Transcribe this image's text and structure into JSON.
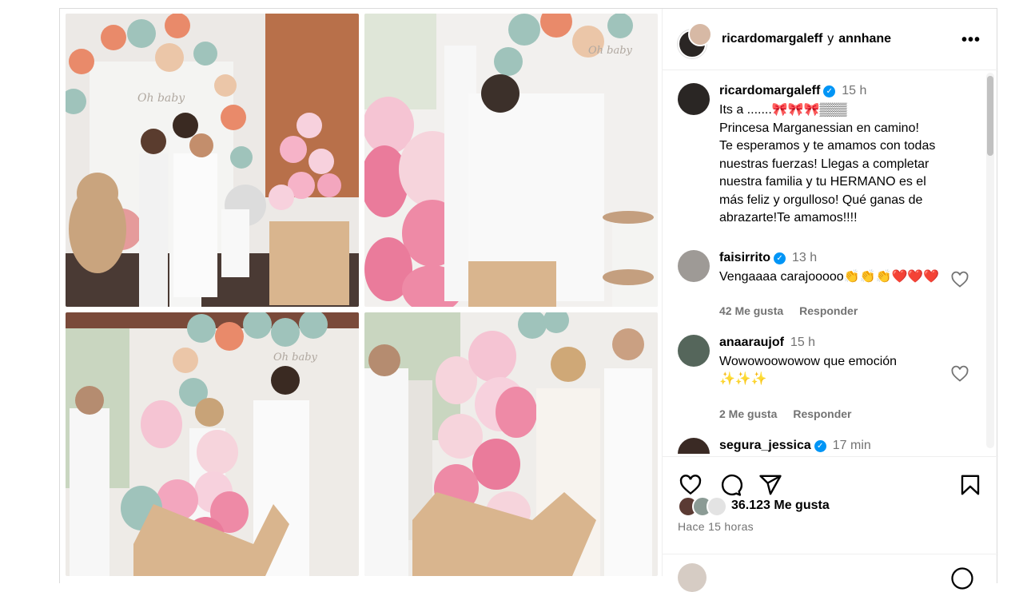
{
  "header": {
    "user1": "ricardomargaleff",
    "conjunction": "y",
    "user2": "annhane",
    "more_label": "•••"
  },
  "caption": {
    "user": "ricardomargaleff",
    "time": "15 h",
    "lines": [
      "Its a .......🎀🎀🎀▒▒▒",
      "Princesa Marganessian en camino!",
      "Te esperamos y te amamos con todas",
      "nuestras fuerzas! Llegas a completar",
      "nuestra familia y tu HERMANO es el",
      "más feliz y orgulloso! Qué ganas de",
      "abrazarte!Te amamos!!!!"
    ]
  },
  "comments": [
    {
      "user": "faisirrito",
      "time": "13 h",
      "text": "Vengaaaa carajooooo👏👏👏❤️❤️❤️",
      "likes": "42 Me gusta",
      "reply": "Responder"
    },
    {
      "user": "anaaraujof",
      "time": "15 h",
      "text": "Wowowoowowow que emoción",
      "text2": "✨✨✨",
      "likes": "2 Me gusta",
      "reply": "Responder"
    },
    {
      "user": "segura_jessica",
      "time": "17 min"
    }
  ],
  "post": {
    "likes_count": "36.123 Me gusta",
    "time_ago": "Hace 15 horas"
  },
  "photos": {
    "top_left_sign": "Oh baby",
    "top_right_sign": "Oh baby",
    "bottom_left_sign": "Oh baby"
  },
  "icons": [
    "heart-icon",
    "comment-icon",
    "share-icon",
    "bookmark-icon",
    "more-icon",
    "verified-icon"
  ],
  "colors": {
    "verified": "#0095f6",
    "secondary_text": "#737373",
    "border": "#dbdbdb",
    "heart_red": "#e0245e"
  }
}
